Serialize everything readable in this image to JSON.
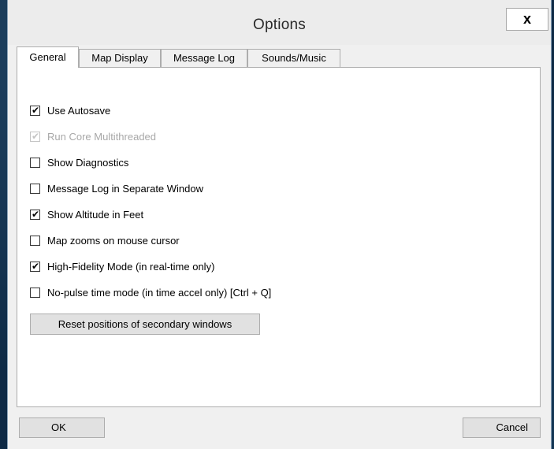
{
  "window": {
    "title": "Options",
    "close_label": "x"
  },
  "tabs": [
    {
      "label": "General",
      "active": true
    },
    {
      "label": "Map Display",
      "active": false
    },
    {
      "label": "Message Log",
      "active": false
    },
    {
      "label": "Sounds/Music",
      "active": false
    }
  ],
  "options": [
    {
      "label": "Use Autosave",
      "checked": true,
      "enabled": true
    },
    {
      "label": "Run Core Multithreaded",
      "checked": true,
      "enabled": false
    },
    {
      "label": "Show Diagnostics",
      "checked": false,
      "enabled": true
    },
    {
      "label": "Message Log in Separate Window",
      "checked": false,
      "enabled": true
    },
    {
      "label": "Show Altitude in Feet",
      "checked": true,
      "enabled": true
    },
    {
      "label": "Map zooms on mouse cursor",
      "checked": false,
      "enabled": true
    },
    {
      "label": "High-Fidelity Mode (in real-time only)",
      "checked": true,
      "enabled": true
    },
    {
      "label": "No-pulse time mode (in time accel only) [Ctrl + Q]",
      "checked": false,
      "enabled": true
    }
  ],
  "check_glyph": "✔",
  "reset_button_label": "Reset positions of secondary windows",
  "footer": {
    "ok_label": "OK",
    "cancel_label": "Cancel"
  }
}
